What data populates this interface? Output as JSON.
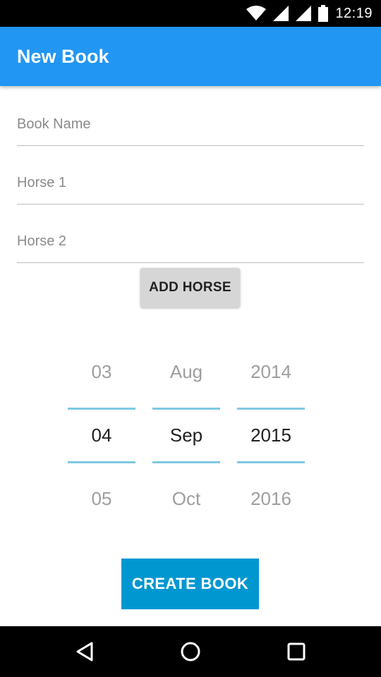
{
  "status_bar": {
    "time": "12:19",
    "icons": [
      "wifi-icon",
      "signal-icon",
      "signal-icon",
      "battery-icon"
    ]
  },
  "app_bar": {
    "title": "New Book",
    "color": "#2196f3"
  },
  "form": {
    "book_name": {
      "placeholder": "Book Name",
      "value": ""
    },
    "horse1": {
      "placeholder": "Horse 1",
      "value": ""
    },
    "horse2": {
      "placeholder": "Horse 2",
      "value": ""
    },
    "add_horse_label": "ADD HORSE"
  },
  "date_picker": {
    "day": {
      "prev": "03",
      "current": "04",
      "next": "05"
    },
    "month": {
      "prev": "Aug",
      "current": "Sep",
      "next": "Oct"
    },
    "year": {
      "prev": "2014",
      "current": "2015",
      "next": "2016"
    }
  },
  "create_book_label": "CREATE BOOK",
  "accent_color": "#0097d1",
  "nav_bar": {
    "icons": [
      "back-icon",
      "home-icon",
      "recents-icon"
    ]
  }
}
